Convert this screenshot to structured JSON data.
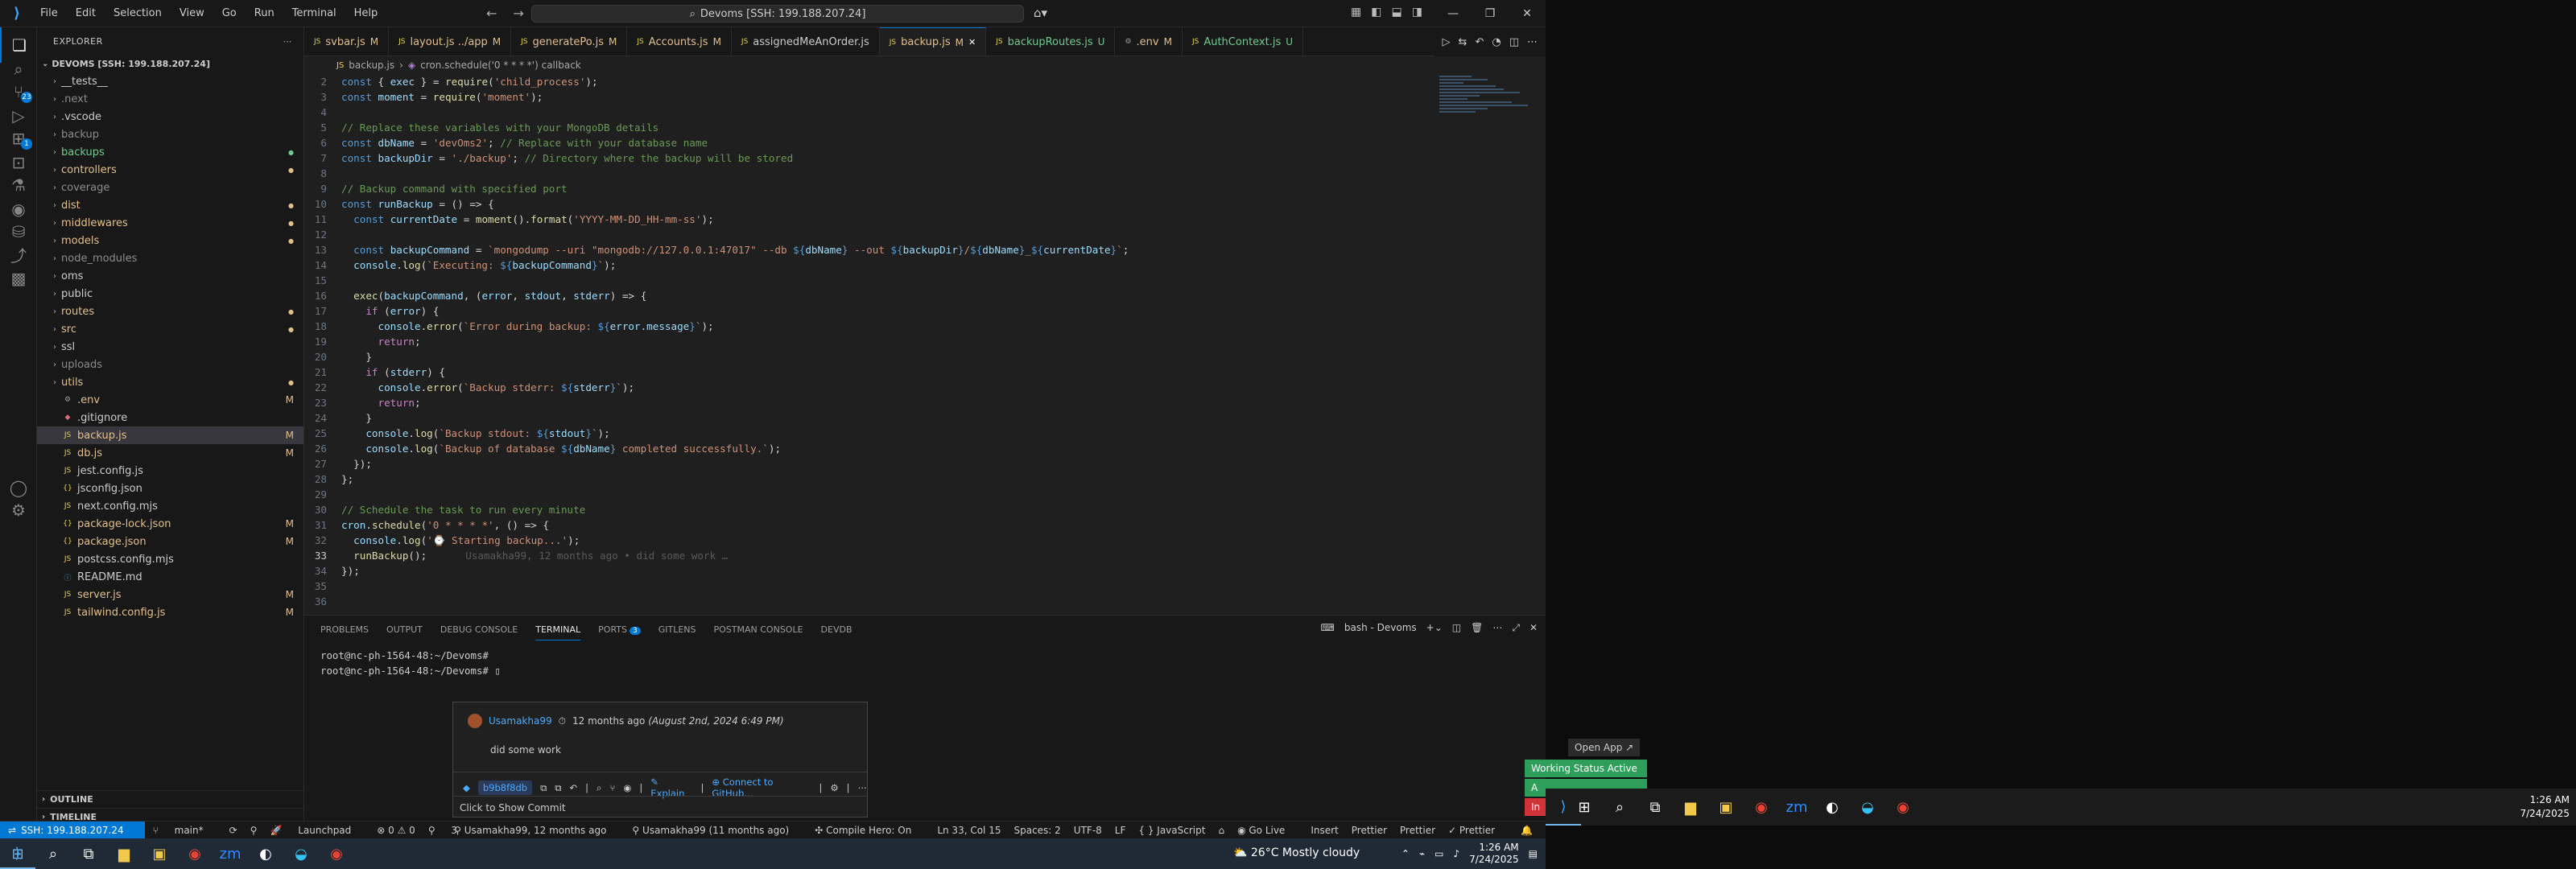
{
  "titlebar": {
    "menu": [
      "File",
      "Edit",
      "Selection",
      "View",
      "Go",
      "Run",
      "Terminal",
      "Help"
    ],
    "command_center": "Devoms [SSH: 199.188.207.24]"
  },
  "explorer": {
    "title": "EXPLORER",
    "root": "DEVOMS [SSH: 199.188.207.24]",
    "items": [
      {
        "name": "__tests__",
        "type": "folder",
        "status": "",
        "color": "#cccccc"
      },
      {
        "name": ".next",
        "type": "folder",
        "status": "",
        "color": "#8c8c8c"
      },
      {
        "name": ".vscode",
        "type": "folder",
        "status": "",
        "color": "#cccccc"
      },
      {
        "name": "backup",
        "type": "folder",
        "status": "",
        "color": "#8c8c8c"
      },
      {
        "name": "backups",
        "type": "folder",
        "status": "dot",
        "color": "#73c991"
      },
      {
        "name": "controllers",
        "type": "folder",
        "status": "dot",
        "color": "#e2c08d"
      },
      {
        "name": "coverage",
        "type": "folder",
        "status": "",
        "color": "#8c8c8c"
      },
      {
        "name": "dist",
        "type": "folder",
        "status": "dot",
        "color": "#e2c08d"
      },
      {
        "name": "middlewares",
        "type": "folder",
        "status": "dot",
        "color": "#e2c08d"
      },
      {
        "name": "models",
        "type": "folder",
        "status": "dot",
        "color": "#e2c08d"
      },
      {
        "name": "node_modules",
        "type": "folder",
        "status": "",
        "color": "#8c8c8c"
      },
      {
        "name": "oms",
        "type": "folder",
        "status": "",
        "color": "#cccccc"
      },
      {
        "name": "public",
        "type": "folder",
        "status": "",
        "color": "#cccccc"
      },
      {
        "name": "routes",
        "type": "folder",
        "status": "dot",
        "color": "#e2c08d"
      },
      {
        "name": "src",
        "type": "folder",
        "status": "dot",
        "color": "#e2c08d"
      },
      {
        "name": "ssl",
        "type": "folder",
        "status": "",
        "color": "#cccccc"
      },
      {
        "name": "uploads",
        "type": "folder",
        "status": "",
        "color": "#8c8c8c"
      },
      {
        "name": "utils",
        "type": "folder",
        "status": "dot",
        "color": "#e2c08d"
      },
      {
        "name": ".env",
        "type": "file",
        "status": "M",
        "color": "#e2c08d"
      },
      {
        "name": ".gitignore",
        "type": "file",
        "status": "",
        "color": "#cccccc"
      },
      {
        "name": "backup.js",
        "type": "file",
        "status": "M",
        "color": "#e2c08d"
      },
      {
        "name": "db.js",
        "type": "file",
        "status": "M",
        "color": "#e2c08d"
      },
      {
        "name": "jest.config.js",
        "type": "file",
        "status": "",
        "color": "#cccccc"
      },
      {
        "name": "jsconfig.json",
        "type": "file",
        "status": "",
        "color": "#cccccc"
      },
      {
        "name": "next.config.mjs",
        "type": "file",
        "status": "",
        "color": "#cccccc"
      },
      {
        "name": "package-lock.json",
        "type": "file",
        "status": "M",
        "color": "#e2c08d"
      },
      {
        "name": "package.json",
        "type": "file",
        "status": "M",
        "color": "#e2c08d"
      },
      {
        "name": "postcss.config.mjs",
        "type": "file",
        "status": "",
        "color": "#cccccc"
      },
      {
        "name": "README.md",
        "type": "file",
        "status": "",
        "color": "#cccccc"
      },
      {
        "name": "server.js",
        "type": "file",
        "status": "M",
        "color": "#e2c08d"
      },
      {
        "name": "tailwind.config.js",
        "type": "file",
        "status": "M",
        "color": "#e2c08d"
      }
    ],
    "outline": "OUTLINE",
    "timeline": "TIMELINE"
  },
  "tabs": [
    {
      "label": "svbar.js",
      "mark": "M",
      "color": "#e2c08d",
      "active": false
    },
    {
      "label": "layout.js ../app",
      "mark": "M",
      "color": "#e2c08d",
      "active": false
    },
    {
      "label": "generatePo.js",
      "mark": "M",
      "color": "#e2c08d",
      "active": false
    },
    {
      "label": "Accounts.js",
      "mark": "M",
      "color": "#e2c08d",
      "active": false
    },
    {
      "label": "assignedMeAnOrder.js",
      "mark": "",
      "color": "#cccccc",
      "active": false
    },
    {
      "label": "backup.js",
      "mark": "M",
      "color": "#e2c08d",
      "active": true
    },
    {
      "label": "backupRoutes.js",
      "mark": "U",
      "color": "#73c991",
      "active": false
    },
    {
      "label": ".env",
      "mark": "M",
      "color": "#e2c08d",
      "active": false
    },
    {
      "label": "AuthContext.js",
      "mark": "U",
      "color": "#73c991",
      "active": false
    }
  ],
  "breadcrumb": {
    "file": "backup.js",
    "symbol": "cron.schedule('0 * * * *') callback"
  },
  "code_lines": [
    {
      "n": "2",
      "t": "const { exec } = require('child_process');"
    },
    {
      "n": "3",
      "t": "const moment = require('moment');"
    },
    {
      "n": "4",
      "t": ""
    },
    {
      "n": "5",
      "t": "// Replace these variables with your MongoDB details"
    },
    {
      "n": "6",
      "t": "const dbName = 'devOms2'; // Replace with your database name"
    },
    {
      "n": "7",
      "t": "const backupDir = './backup'; // Directory where the backup will be stored"
    },
    {
      "n": "8",
      "t": ""
    },
    {
      "n": "9",
      "t": "// Backup command with specified port"
    },
    {
      "n": "10",
      "t": "const runBackup = () => {"
    },
    {
      "n": "11",
      "t": "  const currentDate = moment().format('YYYY-MM-DD_HH-mm-ss');"
    },
    {
      "n": "12",
      "t": ""
    },
    {
      "n": "13",
      "t": "  const backupCommand = `mongodump --uri \"mongodb://127.0.0.1:47017\" --db ${dbName} --out ${backupDir}/${dbName}_${currentDate}`;"
    },
    {
      "n": "14",
      "t": "  console.log(`Executing: ${backupCommand}`);"
    },
    {
      "n": "15",
      "t": ""
    },
    {
      "n": "16",
      "t": "  exec(backupCommand, (error, stdout, stderr) => {"
    },
    {
      "n": "17",
      "t": "    if (error) {"
    },
    {
      "n": "18",
      "t": "      console.error(`Error during backup: ${error.message}`);"
    },
    {
      "n": "19",
      "t": "      return;"
    },
    {
      "n": "20",
      "t": "    }"
    },
    {
      "n": "21",
      "t": "    if (stderr) {"
    },
    {
      "n": "22",
      "t": "      console.error(`Backup stderr: ${stderr}`);"
    },
    {
      "n": "23",
      "t": "      return;"
    },
    {
      "n": "24",
      "t": "    }"
    },
    {
      "n": "25",
      "t": "    console.log(`Backup stdout: ${stdout}`);"
    },
    {
      "n": "26",
      "t": "    console.log(`Backup of database ${dbName} completed successfully.`);"
    },
    {
      "n": "27",
      "t": "  });"
    },
    {
      "n": "28",
      "t": "};"
    },
    {
      "n": "29",
      "t": ""
    },
    {
      "n": "30",
      "t": "// Schedule the task to run every minute"
    },
    {
      "n": "31",
      "t": "cron.schedule('0 * * * *', () => {"
    },
    {
      "n": "32",
      "t": "  console.log('⌚ Starting backup...');"
    },
    {
      "n": "33",
      "t": "  runBackup();"
    },
    {
      "n": "34",
      "t": "});"
    },
    {
      "n": "35",
      "t": ""
    },
    {
      "n": "36",
      "t": ""
    }
  ],
  "blame_ghost": "Usamakha99, 12 months ago • did some work …",
  "panel": {
    "tabs": [
      "PROBLEMS",
      "OUTPUT",
      "DEBUG CONSOLE",
      "TERMINAL",
      "PORTS",
      "GITLENS",
      "POSTMAN CONSOLE",
      "DEVDB"
    ],
    "ports_count": "3",
    "terminal_name": "bash - Devoms",
    "terminal_lines": [
      "root@nc-ph-1564-48:~/Devoms#",
      "root@nc-ph-1564-48:~/Devoms# ▯"
    ]
  },
  "hover": {
    "author": "Usamakha99",
    "time": "12 months ago",
    "date": "(August 2nd, 2024 6:49 PM)",
    "message": "did some work",
    "hash": "b9b8f8db",
    "explain": "Explain",
    "github": "Connect to GitHub...",
    "footer": "Click to Show Commit"
  },
  "statusbar": {
    "remote": "SSH: 199.188.207.24",
    "branch": "main*",
    "launchpad": "Launchpad",
    "problems": "⊗ 0 ⚠ 0",
    "ports": "3",
    "blame1": "Usamakha99, 12 months ago",
    "blame2": "Usamakha99 (11 months ago)",
    "compile": "Compile Hero: On",
    "position": "Ln 33, Col 15",
    "spaces": "Spaces: 2",
    "encoding": "UTF-8",
    "eol": "LF",
    "language": "{ } JavaScript",
    "golive": "Go Live",
    "insert": "Insert",
    "prettier1": "Prettier",
    "prettier2": "Prettier",
    "prettier3": "Prettier"
  },
  "taskbar_left": {
    "weather": "26°C  Mostly cloudy",
    "time": "1:26 AM",
    "date": "7/24/2025"
  },
  "popups": {
    "open_app": "Open App ↗",
    "working_status": "Working Status Active",
    "a1": "A",
    "a2": "In"
  },
  "taskbar_right": {
    "time": "1:26 AM",
    "date": "7/24/2025"
  },
  "colors": {
    "accent": "#0078d4",
    "modified": "#e2c08d",
    "untracked": "#73c991"
  }
}
